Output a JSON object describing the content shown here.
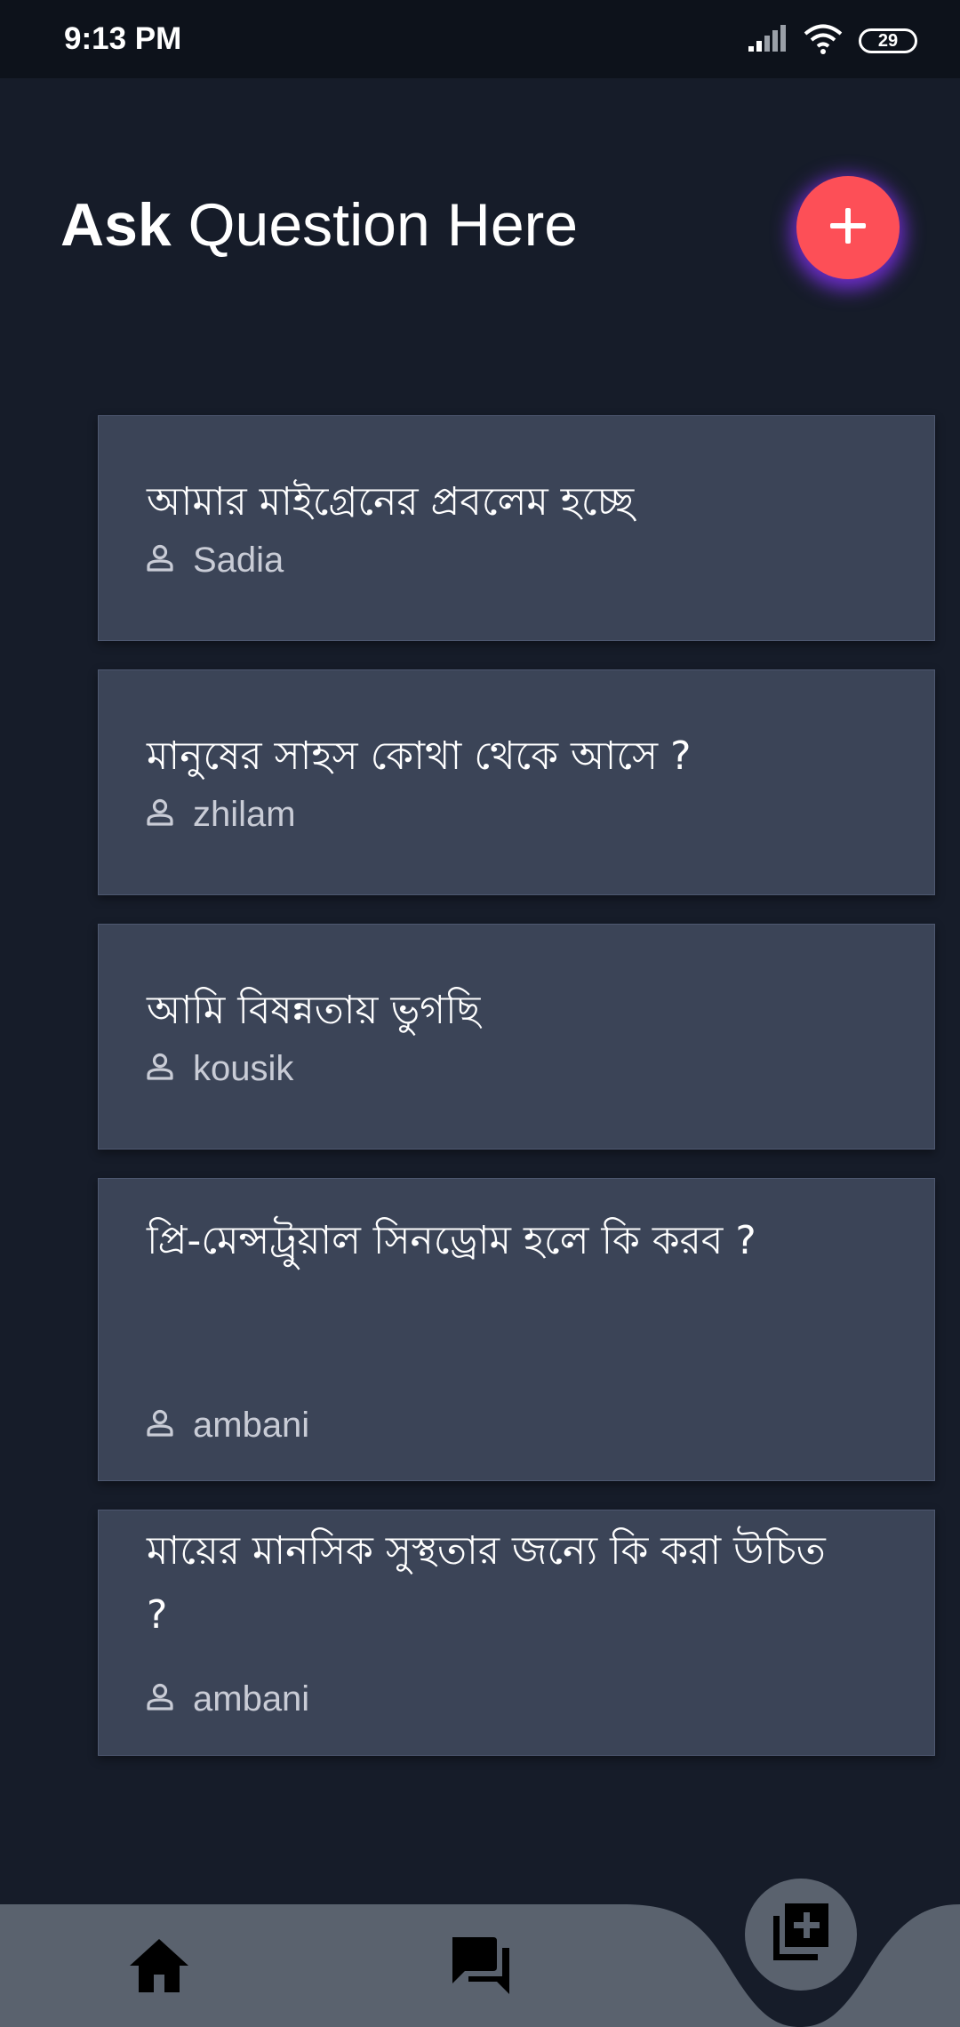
{
  "status_bar": {
    "time": "9:13 PM",
    "battery": "29"
  },
  "header": {
    "title_bold": "Ask",
    "title_light": "Question Here"
  },
  "questions": [
    {
      "question": "আমার মাইগ্রেনের প্রবলেম হচ্ছে",
      "author": "Sadia"
    },
    {
      "question": "মানুষের সাহস কোথা থেকে আসে ?",
      "author": "zhilam"
    },
    {
      "question": "আমি বিষন্নতায় ভুগছি",
      "author": "kousik"
    },
    {
      "question": "প্রি-মেন্সট্রুয়াল সিনড্রোম হলে কি করব ?",
      "author": "ambani"
    },
    {
      "question": "মায়ের মানসিক সুস্থতার জন্যে কি করা উচিত ?",
      "author": "ambani"
    }
  ],
  "colors": {
    "background": "#161c29",
    "card": "#3b4457",
    "accent": "#fd4f57",
    "fab_glow": "#7c30e6",
    "nav_bar": "#5a626e"
  },
  "icons": {
    "fab": "plus-icon",
    "author": "person-outline-icon",
    "nav_home": "home-icon",
    "nav_questions": "forum-icon",
    "nav_center": "add-to-queue-icon"
  }
}
